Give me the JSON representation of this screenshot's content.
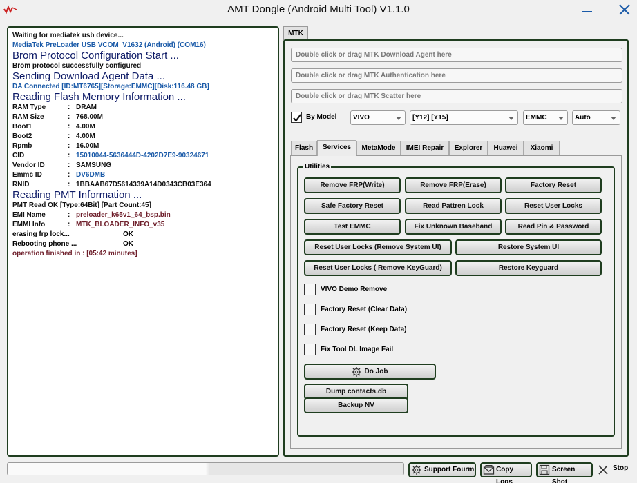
{
  "window": {
    "title": "AMT Dongle (Android Multi Tool) V1.1.0"
  },
  "log": {
    "waiting": "Waiting for mediatek usb device...",
    "port": "MediaTek PreLoader USB VCOM_V1632 (Android) (COM16)",
    "brom_heading": "Brom Protocol Configuration Start ...",
    "brom_ok": "Brom protocol successfully configured",
    "da_heading": "Sending Download Agent Data ...",
    "da_connected": "DA Connected [ID:MT6765][Storage:EMMC][Disk:116.48 GB]",
    "flash_heading": "Reading Flash Memory Information ...",
    "flash_info": [
      {
        "key": "RAM Type",
        "value": "DRAM",
        "color": "plain"
      },
      {
        "key": "RAM Size",
        "value": "768.00M",
        "color": "plain"
      },
      {
        "key": "Boot1",
        "value": "4.00M",
        "color": "plain"
      },
      {
        "key": "Boot2",
        "value": "4.00M",
        "color": "plain"
      },
      {
        "key": "Rpmb",
        "value": "16.00M",
        "color": "plain"
      },
      {
        "key": "CID",
        "value": "15010044-5636444D-4202D7E9-90324671",
        "color": "blue"
      },
      {
        "key": "Vendor ID",
        "value": "SAMSUNG",
        "color": "plain"
      },
      {
        "key": "Emmc ID",
        "value": "DV6DMB",
        "color": "blue"
      },
      {
        "key": "RNID",
        "value": "1BBAAB67D5614339A14D0343CB03E364",
        "color": "plain"
      }
    ],
    "pmt_heading": "Reading PMT Information ...",
    "pmt_read": "PMT Read OK [Type:64Bit] [Part Count:45]",
    "pmt_info": [
      {
        "key": "EMI Name",
        "value": "preloader_k65v1_64_bsp.bin"
      },
      {
        "key": "EMMI Info",
        "value": "MTK_BLOADER_INFO_v35"
      }
    ],
    "status_lines": [
      {
        "text": "erasing frp lock...",
        "result": "OK"
      },
      {
        "text": "Rebooting phone ...",
        "result": "OK"
      }
    ],
    "finished": "operation finished in : [05:42 minutes]"
  },
  "main_tab": "MTK",
  "paths": {
    "download_agent": "Double click or drag MTK Download Agent here",
    "authentication": "Double click or drag MTK Authentication here",
    "scatter": "Double click or drag MTK Scatter here"
  },
  "by_model": {
    "label": "By Model",
    "checked": true
  },
  "selects": {
    "brand": "VIVO",
    "model": "[Y12] [Y15]",
    "storage": "EMMC",
    "mode": "Auto"
  },
  "subtabs": [
    "Flash",
    "Services",
    "MetaMode",
    "IMEI Repair",
    "Explorer",
    "Huawei",
    "Xiaomi"
  ],
  "active_subtab": "Services",
  "utilities": {
    "label": "Utilities",
    "buttons": {
      "remove_frp_write": "Remove FRP(Write)",
      "remove_frp_erase": "Remove FRP(Erase)",
      "factory_reset": "Factory Reset",
      "safe_factory_reset": "Safe Factory Reset",
      "read_pattren_lock": "Read Pattren Lock",
      "reset_user_locks": "Reset User Locks",
      "test_emmc": "Test EMMC",
      "fix_unknown_baseband": "Fix Unknown Baseband",
      "read_pin_password": "Read Pin & Password",
      "reset_locks_system_ui": "Reset User Locks (Remove System UI)",
      "restore_system_ui": "Restore System UI",
      "reset_locks_keyguard": "Reset User Locks ( Remove KeyGuard)",
      "restore_keyguard": "Restore Keyguard"
    },
    "options": {
      "vivo_demo_remove": "VIVO Demo Remove",
      "factory_reset_clear": "Factory Reset (Clear Data)",
      "factory_reset_keep": "Factory Reset (Keep Data)",
      "fix_tool_dl": "Fix Tool DL Image Fail"
    },
    "do_job": "Do Job",
    "dump_contacts": "Dump contacts.db",
    "backup_nv": "Backup NV"
  },
  "footer": {
    "progress": 0.5,
    "support": "Support Fourm",
    "copy_logs": "Copy Logs",
    "screenshot": "Screen Shot",
    "stop": "Stop"
  },
  "colors": {
    "border": "#1f3d1f",
    "log_blue": "#1a5aa8",
    "log_heading": "#0d1a66",
    "log_darkred": "#6e1e2a",
    "logo_red": "#cc2222"
  }
}
